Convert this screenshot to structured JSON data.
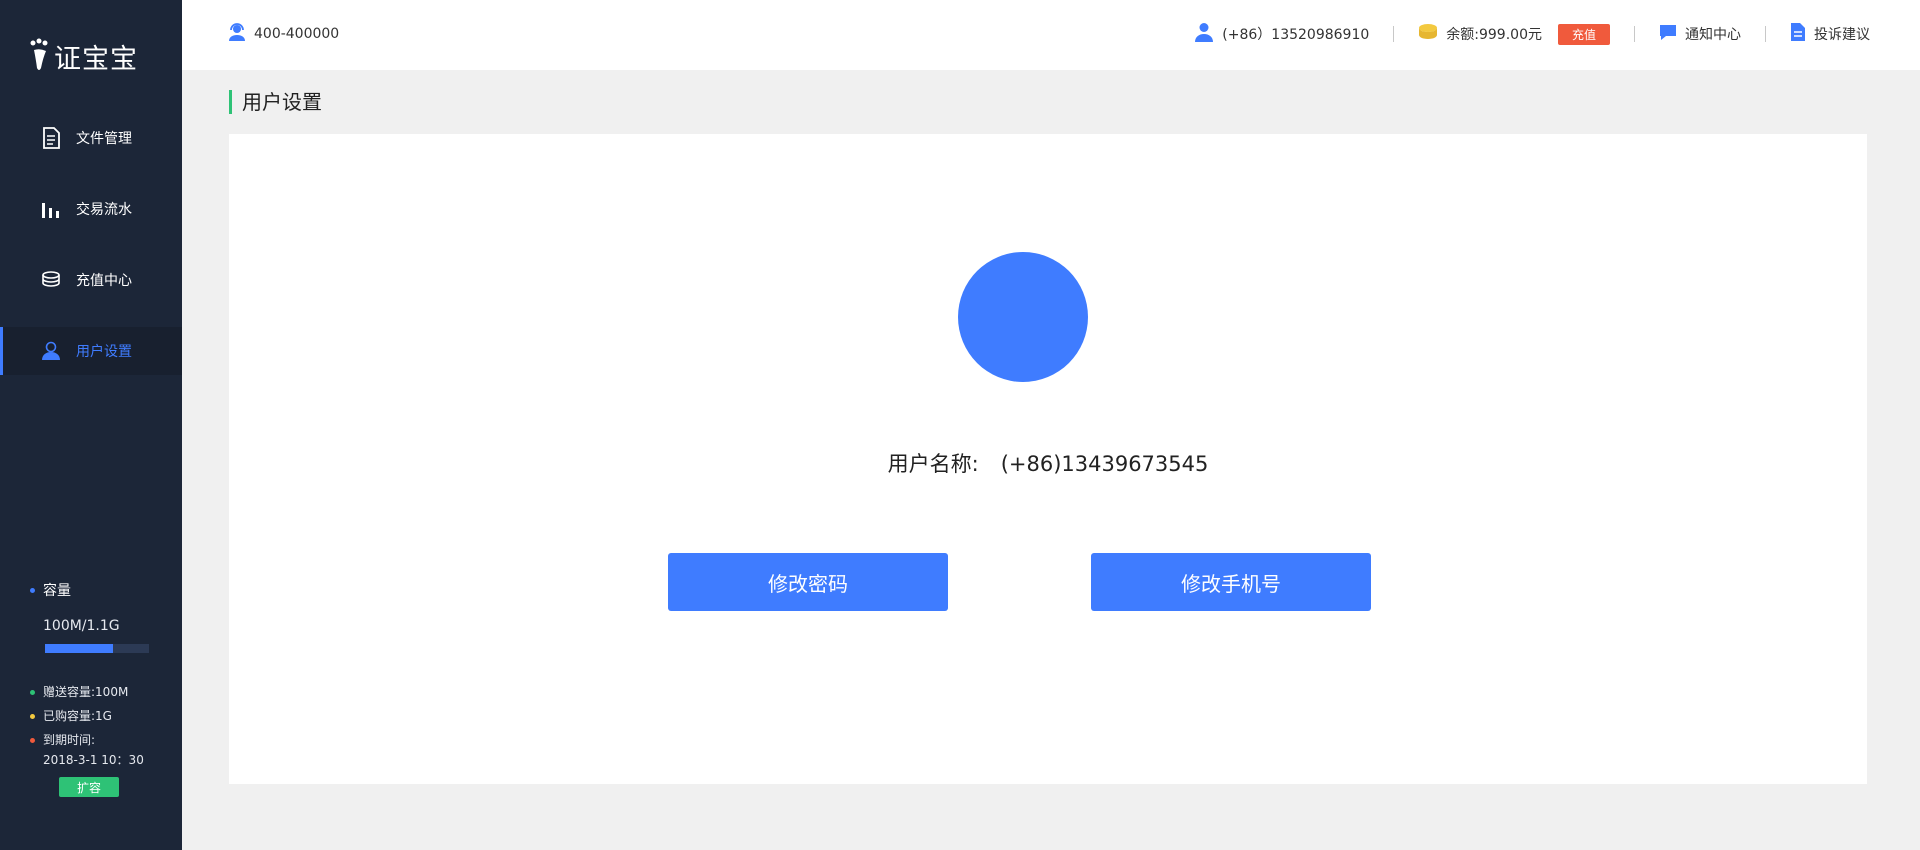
{
  "app": {
    "logo_text": "证宝宝"
  },
  "sidebar": {
    "items": [
      {
        "label": "文件管理",
        "icon": "file-icon"
      },
      {
        "label": "交易流水",
        "icon": "bar-chart-icon"
      },
      {
        "label": "充值中心",
        "icon": "coins-stack-icon"
      },
      {
        "label": "用户设置",
        "icon": "user-icon",
        "active": true
      }
    ],
    "capacity": {
      "title": "容量",
      "value": "100M/1.1G",
      "used_fraction": 0.65,
      "gift": "赠送容量:100M",
      "purchased": "已购容量:1G",
      "expire_label": "到期时间:",
      "expire_value": "2018-3-1 10：30",
      "expand_label": "扩容"
    }
  },
  "header": {
    "hotline": "400-400000",
    "account": "(+86）13520986910",
    "balance": "余额:999.00元",
    "recharge_label": "充值",
    "notifications": "通知中心",
    "feedback": "投诉建议"
  },
  "page": {
    "title": "用户设置",
    "username_label": "用户名称:",
    "username_value": "(+86)13439673545",
    "change_password": "修改密码",
    "change_phone": "修改手机号"
  },
  "colors": {
    "accent": "#3f7cff",
    "sidebar_bg": "#1c2638",
    "green": "#2ec276",
    "red": "#f05a3c",
    "gold": "#f3c93f"
  }
}
